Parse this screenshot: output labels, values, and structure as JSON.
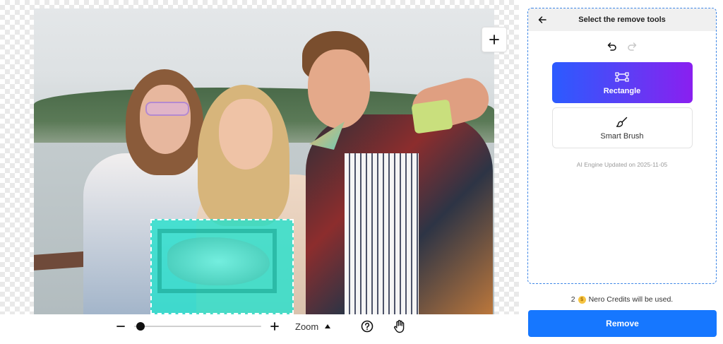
{
  "canvas": {
    "add_icon": "plus-icon",
    "selection_color": "#28e1cd"
  },
  "zoom": {
    "label": "Zoom",
    "level_fraction": 0.05,
    "minus_icon": "minus-icon",
    "plus_icon": "plus-icon",
    "caret_icon": "caret-up-icon",
    "help_icon": "help-circle-icon",
    "pan_icon": "hand-icon"
  },
  "panel": {
    "title": "Select the remove tools",
    "back_icon": "arrow-left-icon",
    "undo_icon": "undo-icon",
    "redo_icon": "redo-icon",
    "tools": [
      {
        "label": "Rectangle",
        "icon": "rectangle-select-icon",
        "active": true
      },
      {
        "label": "Smart Brush",
        "icon": "brush-icon",
        "active": false
      }
    ],
    "engine_note": "AI Engine Updated on 2025-11-05"
  },
  "footer": {
    "credits_count": "2",
    "credits_text": "Nero Credits will be used.",
    "coin_icon": "coin-icon",
    "remove_label": "Remove",
    "accent_color": "#1677ff"
  }
}
